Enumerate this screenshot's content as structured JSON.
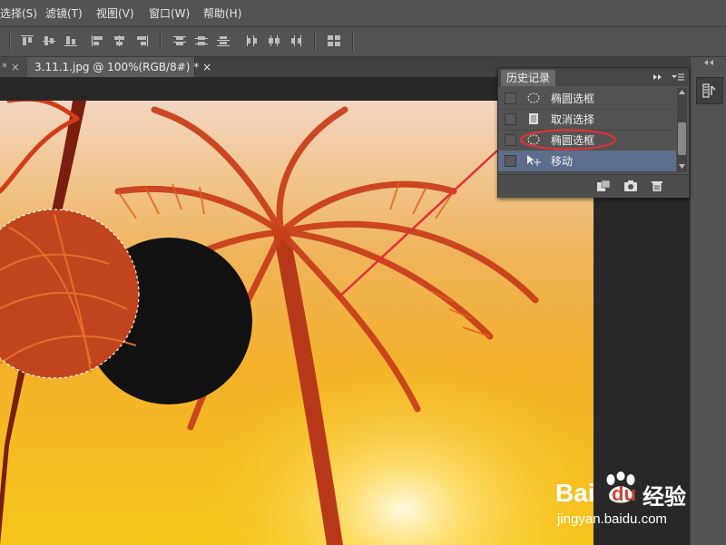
{
  "menubar": {
    "items": [
      "选择(S)",
      "滤镜(T)",
      "视图(V)",
      "窗口(W)",
      "帮助(H)"
    ]
  },
  "tabs": {
    "prev_label": "* ×",
    "active_label": "3.11.1.jpg @ 100%(RGB/8#) * ×"
  },
  "history_panel": {
    "title": "历史记录",
    "items": [
      {
        "label": "椭圆选框",
        "icon": "ellipse-marquee-icon"
      },
      {
        "label": "取消选择",
        "icon": "document-icon"
      },
      {
        "label": "椭圆选框",
        "icon": "ellipse-marquee-icon"
      },
      {
        "label": "移动",
        "icon": "move-tool-icon",
        "selected": true
      }
    ],
    "footer_icons": [
      "new-document-from-state-icon",
      "camera-snapshot-icon",
      "trash-icon"
    ]
  },
  "watermark": {
    "brand": "Bai",
    "brand2": "du",
    "text": "经验",
    "url": "jingyan.baidu.com"
  },
  "colors": {
    "accent_annotation": "#e0303a",
    "selected_row": "#5c6e8c"
  }
}
